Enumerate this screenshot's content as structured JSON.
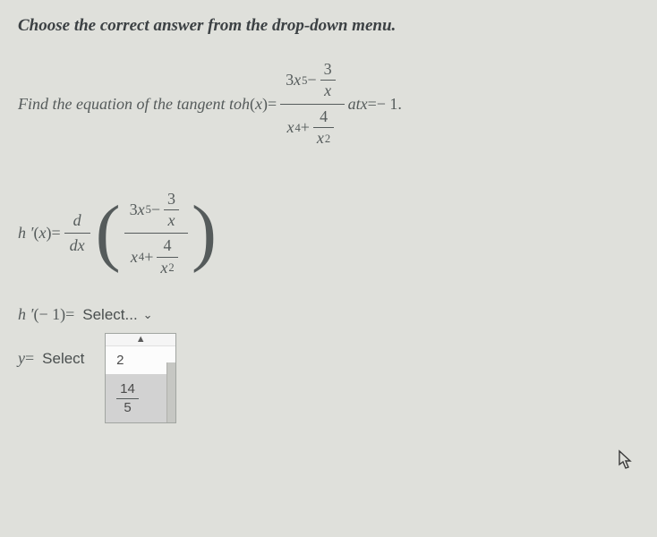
{
  "instruction": "Choose the correct answer from the drop-down menu.",
  "problem": {
    "prefix": "Find the equation of the tangent to ",
    "func": "h",
    "funcarg": "x",
    "eq": " = ",
    "rhs_numer_a": "3",
    "rhs_numer_var_x": "x",
    "rhs_numer_exp5": "5",
    "minus": " − ",
    "three": "3",
    "rhs_denom_plus": " + ",
    "four": "4",
    "two": "2",
    "at_text": " at ",
    "x_eq": "x",
    "eq2": " = ",
    "neg1": " − 1",
    "period": "."
  },
  "deriv": {
    "h_prime": "h ′",
    "arg_x": "x",
    "eq": " = ",
    "d_top": "d",
    "d_bot": "dx"
  },
  "eval": {
    "h_prime_label": "h ′",
    "arg_neg1": "− 1",
    "eq": " = ",
    "select_text": "Select..."
  },
  "y_row": {
    "y_label": "y",
    "eq": " = ",
    "select_text": "Select"
  },
  "menu": {
    "item1": "2",
    "item2_num": "14",
    "item2_den": "5"
  }
}
